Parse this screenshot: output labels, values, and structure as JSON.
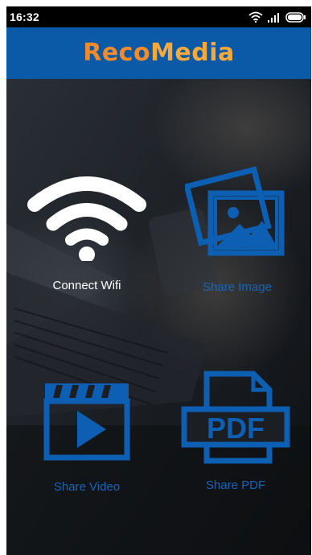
{
  "status_bar": {
    "time": "16:32",
    "icons": [
      "wifi-icon",
      "signal-icon",
      "battery-icon"
    ]
  },
  "app_bar": {
    "title_part1": "Reco",
    "title_part2": "Media"
  },
  "colors": {
    "app_bar": "#0b5aa8",
    "title_orange": "#f08a2a",
    "icon_blue": "#0d5fb3",
    "label_white": "#ffffff",
    "label_blue": "#1565b8"
  },
  "tiles": [
    {
      "id": "connect-wifi",
      "label": "Connect Wifi",
      "icon": "wifi-icon"
    },
    {
      "id": "share-image",
      "label": "Share Image",
      "icon": "image-icon"
    },
    {
      "id": "share-video",
      "label": "Share Video",
      "icon": "video-icon"
    },
    {
      "id": "share-pdf",
      "label": "Share PDF",
      "icon": "pdf-icon"
    }
  ],
  "pdf_icon_text": "PDF"
}
